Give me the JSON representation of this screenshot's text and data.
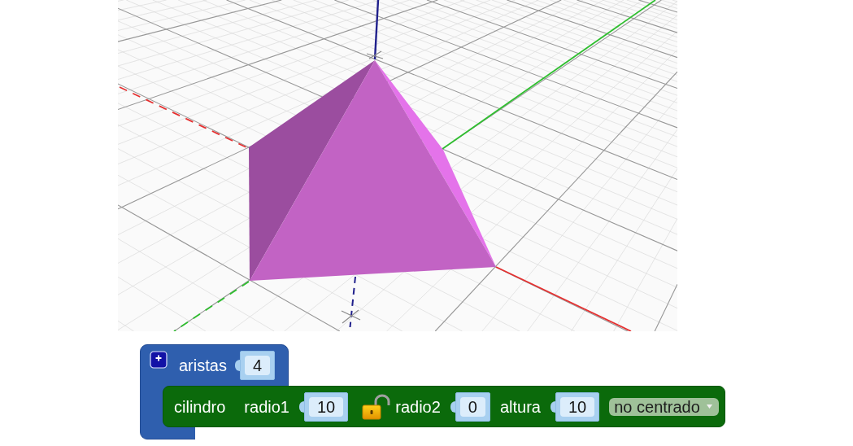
{
  "blocks": [
    {
      "kind": "container",
      "label": "aristas",
      "value": "4",
      "statements": [
        {
          "kind": "statement",
          "label": "cilindro",
          "parts": [
            {
              "kind": "label",
              "text": "radio1"
            },
            {
              "kind": "number",
              "value": "10"
            },
            {
              "kind": "lock",
              "locked": false
            },
            {
              "kind": "label",
              "text": "radio2"
            },
            {
              "kind": "number",
              "value": "0"
            },
            {
              "kind": "label",
              "text": "altura"
            },
            {
              "kind": "number",
              "value": "10"
            },
            {
              "kind": "dropdown",
              "value": "no centrado"
            }
          ]
        }
      ]
    }
  ]
}
